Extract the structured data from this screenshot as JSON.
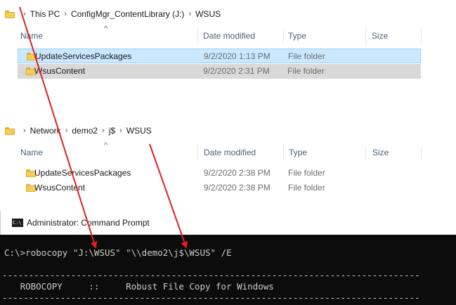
{
  "window1": {
    "breadcrumb": [
      "This PC",
      "ConfigMgr_ContentLibrary (J:)",
      "WSUS"
    ],
    "columns": {
      "name": "Name",
      "date": "Date modified",
      "type": "Type",
      "size": "Size"
    },
    "rows": [
      {
        "name": "UpdateServicesPackages",
        "date": "9/2/2020 1:13 PM",
        "type": "File folder"
      },
      {
        "name": "WsusContent",
        "date": "9/2/2020 2:31 PM",
        "type": "File folder"
      }
    ]
  },
  "window2": {
    "breadcrumb": [
      "Network",
      "demo2",
      "j$",
      "WSUS"
    ],
    "columns": {
      "name": "Name",
      "date": "Date modified",
      "type": "Type",
      "size": "Size"
    },
    "rows": [
      {
        "name": "UpdateServicesPackages",
        "date": "9/2/2020 2:38 PM",
        "type": "File folder"
      },
      {
        "name": "WsusContent",
        "date": "9/2/2020 2:38 PM",
        "type": "File folder"
      }
    ]
  },
  "cmd": {
    "title": "Administrator: Command Prompt",
    "icon_text": "C:\\",
    "command": "C:\\>robocopy \"J:\\WSUS\" \"\\\\demo2\\j$\\WSUS\" /E",
    "rule": "-------------------------------------------------------------------------------",
    "banner": "   ROBOCOPY     ::     Robust File Copy for Windows"
  },
  "colors": {
    "arrow": "#e02020",
    "selected": "#cce8ff",
    "console_bg": "#0c0c0c"
  }
}
